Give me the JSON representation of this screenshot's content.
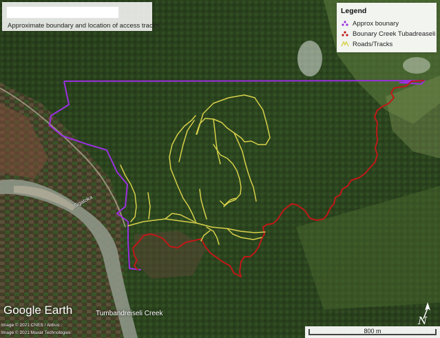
{
  "title": {
    "text": "Approximate boundary and location of access tracks"
  },
  "legend": {
    "title": "Legend",
    "items": [
      {
        "label": "Approx bounary",
        "color": "#9b30e0",
        "icon": "purple-marker-icon"
      },
      {
        "label": "Bounary Creek Tubadreaseli",
        "color": "#c01818",
        "icon": "red-marker-icon"
      },
      {
        "label": "Roads/Tracks",
        "color": "#d8d14a",
        "icon": "yellow-track-icon"
      }
    ]
  },
  "labels": {
    "river": "Sigatoka",
    "creek": "Tumbandreiseli Creek"
  },
  "branding": {
    "google_earth": "Google Earth",
    "credit_1": "Image © 2021 CNES / Airbus",
    "credit_2": "Image © 2021 Maxar Technologies"
  },
  "scale": {
    "label": "800 m"
  },
  "north": {
    "label": "N",
    "icon": "north-arrow-icon"
  },
  "colors": {
    "boundary": "#9b30e0",
    "creek": "#c01818",
    "tracks": "#d8d14a"
  }
}
